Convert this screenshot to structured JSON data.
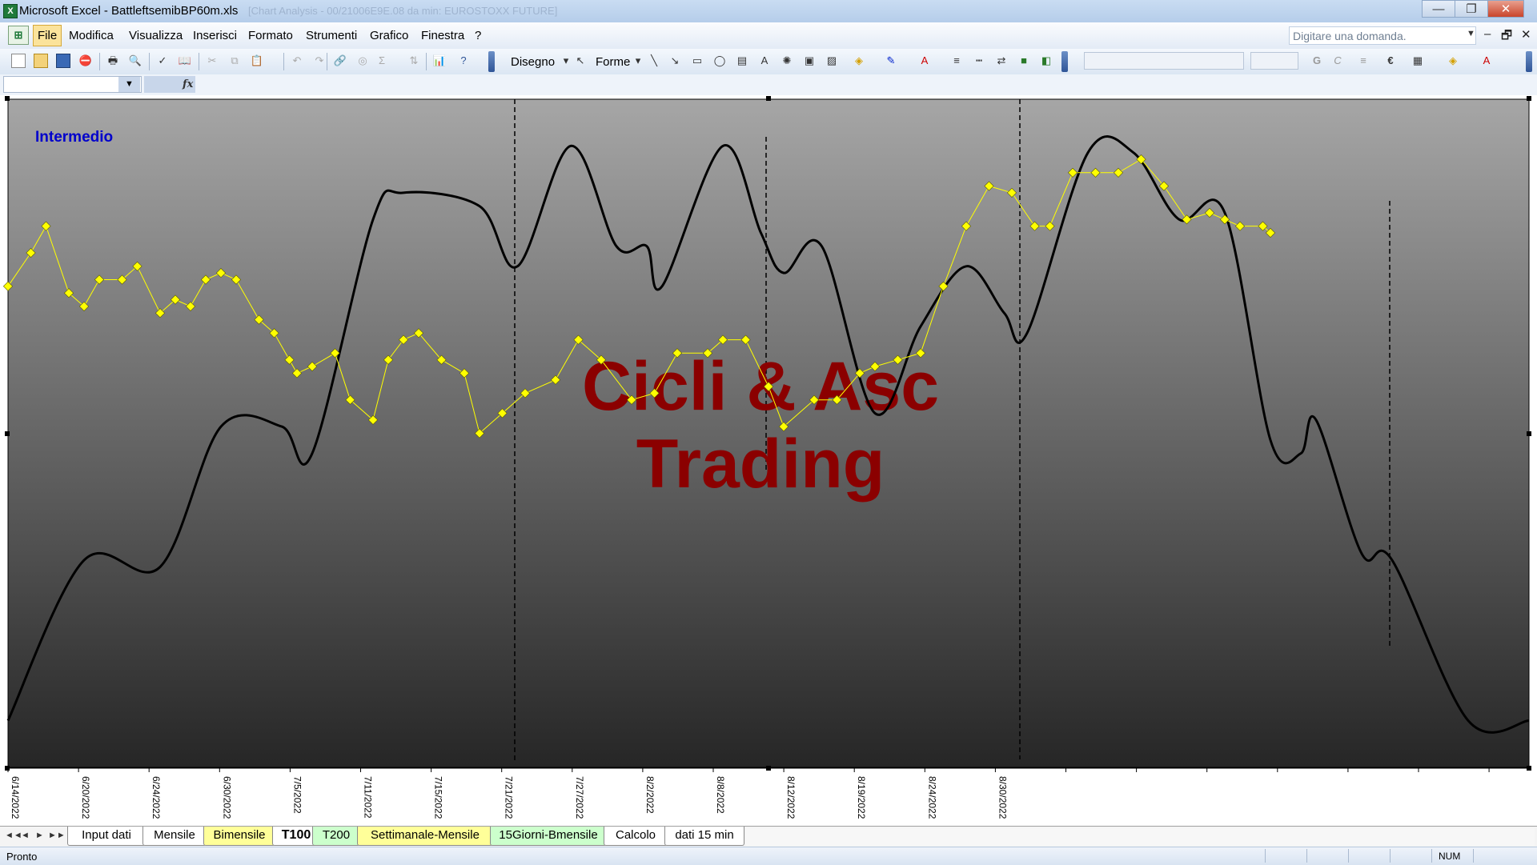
{
  "window": {
    "title": "Microsoft Excel - BattleftsemibBP60m.xls",
    "subtitle": "[Chart Analysis - 00/21006E9E.08 da min: EUROSTOXX FUTURE]",
    "minimize": "—",
    "maximize": "❐",
    "close": "✕"
  },
  "menu": {
    "items": [
      "File",
      "Modifica",
      "Visualizza",
      "Inserisci",
      "Formato",
      "Strumenti",
      "Grafico",
      "Finestra",
      "?"
    ],
    "active_index": 0,
    "ask_placeholder": "Digitare una domanda.",
    "mdi_minimize": "–",
    "mdi_restore": "🗗",
    "mdi_close": "✕"
  },
  "toolbar": {
    "disegno": "Disegno",
    "forme": "Forme",
    "icons": [
      "new-icon",
      "open-icon",
      "save-icon",
      "permission-icon",
      "print-icon",
      "print-preview-icon",
      "spelling-icon",
      "research-icon",
      "cut-icon",
      "copy-icon",
      "paste-icon",
      "undo-icon",
      "redo-icon",
      "hyperlink-icon",
      "sum-icon",
      "sort-icon",
      "chart-wizard-icon",
      "help-icon"
    ],
    "bold": "G",
    "italic": "C",
    "euro": "€"
  },
  "formula": {
    "fx": "fx"
  },
  "chart": {
    "label_intermedio": "Intermedio",
    "watermark_line1": "Cicli & Asc",
    "watermark_line2": "Trading",
    "colors": {
      "background_top": "#a6a6a6",
      "background_bottom": "#262626",
      "cycle_line": "#000000",
      "price_series": "#ffff00",
      "watermark": "#8b0000",
      "label": "#0000cc"
    }
  },
  "chart_data": {
    "type": "line",
    "x_tick_labels": [
      "6/14/2022",
      "6/20/2022",
      "6/24/2022",
      "6/30/2022",
      "7/5/2022",
      "7/11/2022",
      "7/15/2022",
      "7/21/2022",
      "7/27/2022",
      "8/2/2022",
      "8/8/2022",
      "8/12/2022",
      "8/19/2022",
      "8/24/2022",
      "8/30/2022"
    ],
    "series": [
      {
        "style": "smooth line",
        "x": [
          0,
          0.05,
          0.1,
          0.14,
          0.18,
          0.2,
          0.24,
          0.26,
          0.31,
          0.335,
          0.37,
          0.4,
          0.42,
          0.43,
          0.47,
          0.495,
          0.51,
          0.535,
          0.57,
          0.6,
          0.63,
          0.655,
          0.67,
          0.71,
          0.74,
          0.77,
          0.8,
          0.83,
          0.85,
          0.86,
          0.89,
          0.91,
          0.96,
          1.0
        ],
        "y": [
          0.07,
          0.31,
          0.3,
          0.51,
          0.51,
          0.47,
          0.82,
          0.86,
          0.84,
          0.75,
          0.93,
          0.78,
          0.78,
          0.72,
          0.93,
          0.8,
          0.74,
          0.78,
          0.53,
          0.66,
          0.75,
          0.68,
          0.65,
          0.92,
          0.92,
          0.82,
          0.83,
          0.49,
          0.47,
          0.52,
          0.32,
          0.31,
          0.07,
          0.07
        ]
      },
      {
        "style": "yellow markers",
        "x": [
          0,
          0.015,
          0.025,
          0.04,
          0.05,
          0.06,
          0.075,
          0.085,
          0.1,
          0.11,
          0.12,
          0.13,
          0.14,
          0.15,
          0.165,
          0.175,
          0.185,
          0.19,
          0.2,
          0.215,
          0.225,
          0.24,
          0.25,
          0.26,
          0.27,
          0.285,
          0.3,
          0.31,
          0.325,
          0.34,
          0.36,
          0.375,
          0.39,
          0.41,
          0.425,
          0.44,
          0.46,
          0.47,
          0.485,
          0.5,
          0.51,
          0.53,
          0.545,
          0.56,
          0.57,
          0.585,
          0.6,
          0.615,
          0.63,
          0.645,
          0.66,
          0.675,
          0.685,
          0.7,
          0.715,
          0.73,
          0.745,
          0.76,
          0.775,
          0.79,
          0.8,
          0.81,
          0.825,
          0.83
        ],
        "y": [
          0.72,
          0.77,
          0.81,
          0.71,
          0.69,
          0.73,
          0.73,
          0.75,
          0.68,
          0.7,
          0.69,
          0.73,
          0.74,
          0.73,
          0.67,
          0.65,
          0.61,
          0.59,
          0.6,
          0.62,
          0.55,
          0.52,
          0.61,
          0.64,
          0.65,
          0.61,
          0.59,
          0.5,
          0.53,
          0.56,
          0.58,
          0.64,
          0.61,
          0.55,
          0.56,
          0.62,
          0.62,
          0.64,
          0.64,
          0.57,
          0.51,
          0.55,
          0.55,
          0.59,
          0.6,
          0.61,
          0.62,
          0.72,
          0.81,
          0.87,
          0.86,
          0.81,
          0.81,
          0.89,
          0.89,
          0.89,
          0.91,
          0.87,
          0.82,
          0.83,
          0.82,
          0.81,
          0.81,
          0.8
        ]
      }
    ],
    "grid": false,
    "legend": "none"
  },
  "tabs": {
    "nav": [
      "◄◄",
      "◄",
      "►",
      "►►"
    ],
    "sheets": [
      {
        "label": "Input dati",
        "color": "#ffffff"
      },
      {
        "label": "Mensile",
        "color": "#ffffff"
      },
      {
        "label": "Bimensile",
        "color": "#ffff99"
      },
      {
        "label": "T100",
        "color": "#ffffff"
      },
      {
        "label": "T200",
        "color": "#ccffcc"
      },
      {
        "label": "Settimanale-Mensile",
        "color": "#ffff99"
      },
      {
        "label": "15Giorni-Bmensile",
        "color": "#ccffcc"
      },
      {
        "label": "Calcolo",
        "color": "#ffffff"
      },
      {
        "label": "dati 15 min",
        "color": "#ffffff"
      }
    ],
    "active_index": 3
  },
  "status": {
    "text": "Pronto",
    "num": "NUM"
  }
}
